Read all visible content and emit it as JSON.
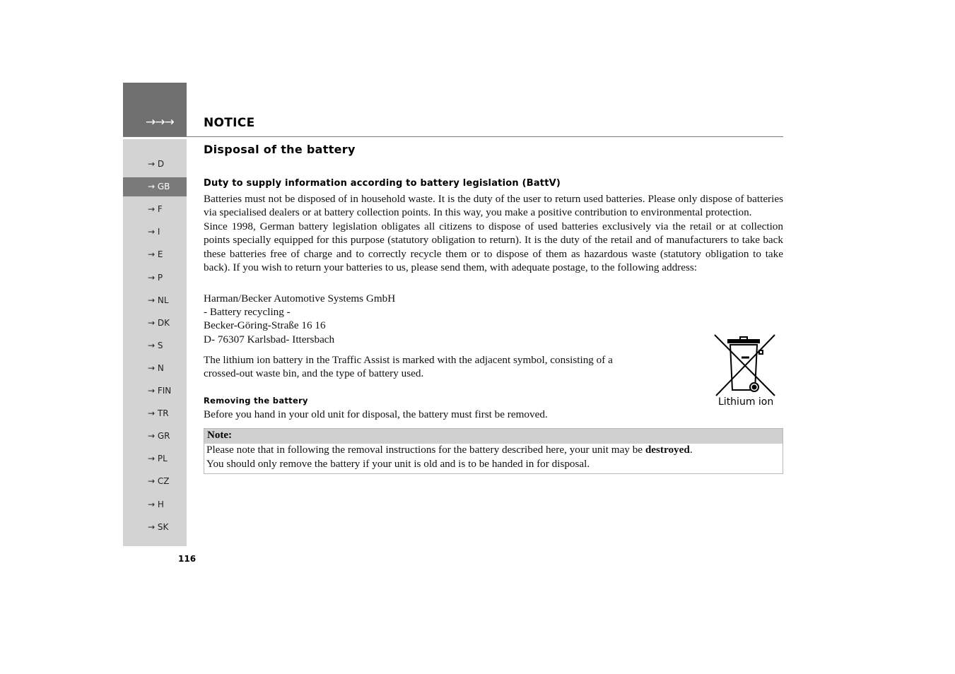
{
  "header": {
    "arrows": "→→→",
    "title": "NOTICE"
  },
  "sidebar": {
    "items": [
      {
        "label": "→ D",
        "active": false
      },
      {
        "label": "→ GB",
        "active": true
      },
      {
        "label": "→ F",
        "active": false
      },
      {
        "label": "→ I",
        "active": false
      },
      {
        "label": "→ E",
        "active": false
      },
      {
        "label": "→ P",
        "active": false
      },
      {
        "label": "→ NL",
        "active": false
      },
      {
        "label": "→ DK",
        "active": false
      },
      {
        "label": "→ S",
        "active": false
      },
      {
        "label": "→ N",
        "active": false
      },
      {
        "label": "→ FIN",
        "active": false
      },
      {
        "label": "→ TR",
        "active": false
      },
      {
        "label": "→ GR",
        "active": false
      },
      {
        "label": "→ PL",
        "active": false
      },
      {
        "label": "→ CZ",
        "active": false
      },
      {
        "label": "→ H",
        "active": false
      },
      {
        "label": "→ SK",
        "active": false
      }
    ]
  },
  "content": {
    "section_title": "Disposal of the battery",
    "subheading": "Duty to supply information according to battery legislation (BattV)",
    "para1": "Batteries must not be disposed of in household waste. It is the duty of the user to return used batteries. Please only dispose of batteries via specialised dealers or at battery collection points. In this way, you make a positive contribution to environmental protection.",
    "para2": "Since 1998, German battery legislation obligates all citizens to dispose of used batteries exclusively via the retail or at collection points specially equipped for this purpose (statutory obligation to return). It is the duty of the retail and of manufacturers to take back these batteries free of charge and to correctly recycle them or to dispose of them as hazardous waste (statutory obligation to take back). If you wish to return your batteries to us, please send them, with adequate postage, to the following address:",
    "address": [
      "Harman/Becker Automotive Systems GmbH",
      "- Battery recycling -",
      "Becker-Göring-Straße 16 16",
      "D- 76307 Karlsbad- Ittersbach"
    ],
    "para3": "The lithium ion battery in the Traffic Assist is marked with the adjacent symbol, consisting of a crossed-out waste bin, and the type of battery used.",
    "figure_caption": "Lithium ion",
    "remove_heading": "Removing the battery",
    "para4": "Before you hand in your old unit for disposal, the battery must first be removed.",
    "note": {
      "label": "Note:",
      "line1_prefix": "Please note that in following the removal instructions for the battery described here, your unit may be ",
      "line1_bold": "destroyed",
      "line1_suffix": ".",
      "line2": "You should only remove the battery if your unit is old and is to be handed in for disposal."
    }
  },
  "footer": {
    "page_number": "116"
  }
}
